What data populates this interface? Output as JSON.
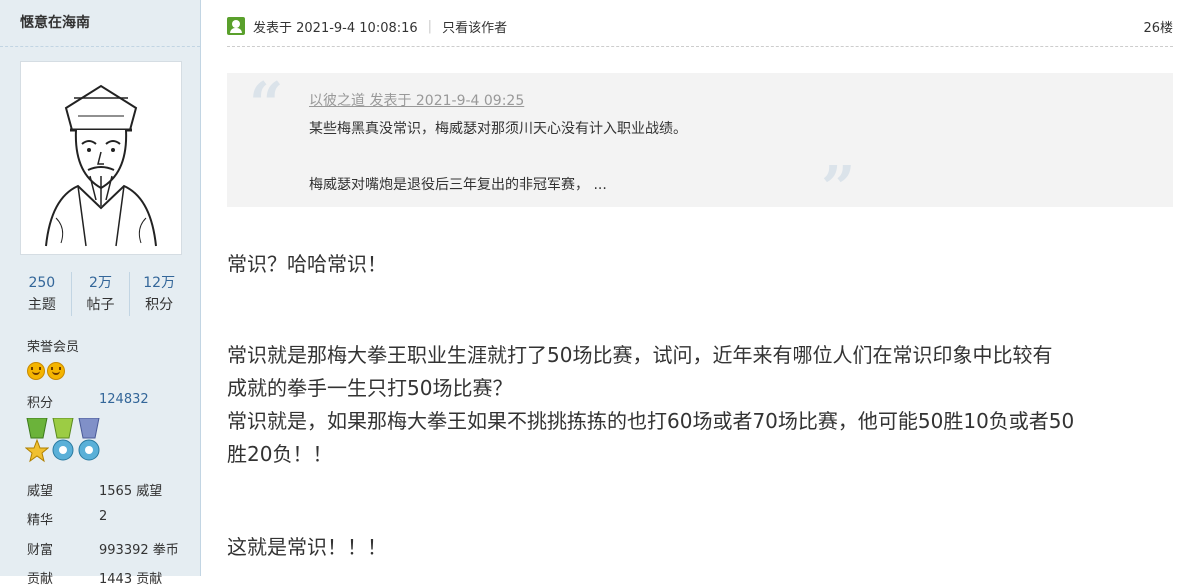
{
  "sidebar": {
    "username": "惬意在海南",
    "stats": [
      {
        "num": "250",
        "label": "主题"
      },
      {
        "num": "2万",
        "label": "帖子"
      },
      {
        "num": "12万",
        "label": "积分"
      }
    ],
    "rank": "荣誉会员",
    "fields": [
      {
        "key": "积分",
        "value": "124832"
      },
      {
        "key": "威望",
        "value": "1565 威望"
      },
      {
        "key": "精华",
        "value": "2"
      },
      {
        "key": "财富",
        "value": "993392 拳币"
      },
      {
        "key": "贡献",
        "value": "1443 贡献"
      }
    ]
  },
  "post": {
    "posted_label": "发表于 2021-9-4 10:08:16",
    "only_author": "只看该作者",
    "floor": "26楼",
    "quote": {
      "author_line": "以彼之道 发表于 2021-9-4 09:25",
      "line1": "某些梅黑真没常识，梅威瑟对那须川天心没有计入职业战绩。",
      "line2": "梅威瑟对嘴炮是退役后三年复出的非冠军赛， ..."
    },
    "paragraphs": [
      "常识？哈哈常识！",
      "常识就是那梅大拳王职业生涯就打了50场比赛，试问，近年来有哪位人们在常识印象中比较有",
      "成就的拳手一生只打50场比赛？",
      "常识就是，如果那梅大拳王如果不挑挑拣拣的也打60场或者70场比赛，他可能50胜10负或者50",
      "胜20负！！",
      "这就是常识！！！"
    ]
  }
}
